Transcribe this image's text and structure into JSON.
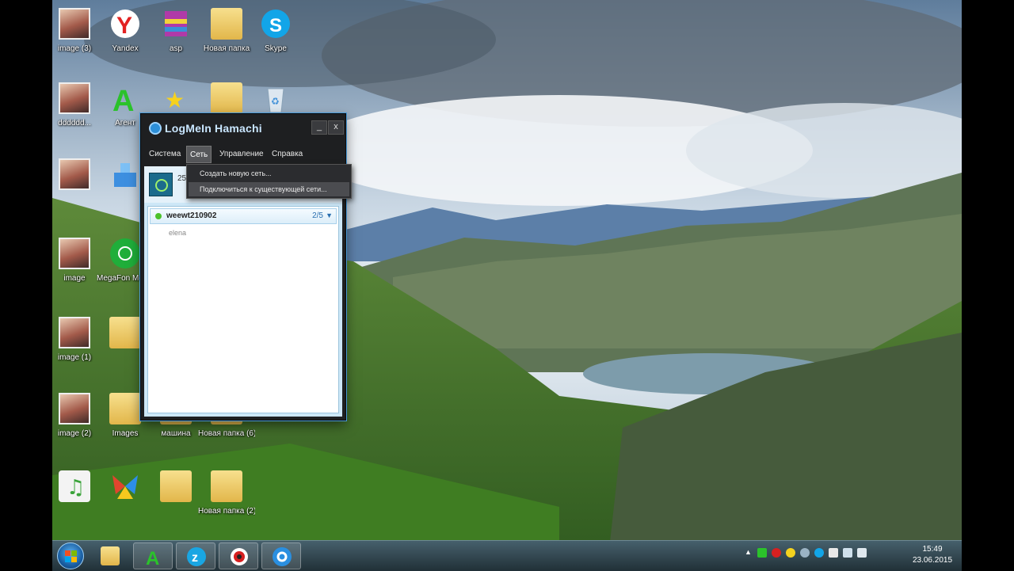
{
  "desktop": {
    "icons": [
      {
        "label": "image (3)",
        "icon": "photo-thumbnail-icon"
      },
      {
        "label": "Yandex",
        "icon": "yandex-browser-icon"
      },
      {
        "label": "asp",
        "icon": "winrar-archive-icon"
      },
      {
        "label": "Новая папка",
        "icon": "folder-icon"
      },
      {
        "label": "Skype",
        "icon": "skype-icon"
      },
      {
        "label": "dddddd...",
        "icon": "photo-thumbnail-icon"
      },
      {
        "label": "Агент",
        "icon": "mail-agent-icon"
      },
      {
        "label": "",
        "icon": "star-icon"
      },
      {
        "label": "",
        "icon": "folder-icon"
      },
      {
        "label": "",
        "icon": "recycle-bin-icon"
      },
      {
        "label": "",
        "icon": "photo-thumbnail-icon"
      },
      {
        "label": "",
        "icon": "shortcut-icon"
      },
      {
        "label": "image",
        "icon": "photo-thumbnail-icon"
      },
      {
        "label": "MegaFon Modem",
        "icon": "megafon-modem-icon"
      },
      {
        "label": "image (1)",
        "icon": "photo-thumbnail-icon"
      },
      {
        "label": "",
        "icon": "folder-icon"
      },
      {
        "label": "image (2)",
        "icon": "photo-thumbnail-icon"
      },
      {
        "label": "Images",
        "icon": "folder-icon"
      },
      {
        "label": "машина",
        "icon": "folder-icon"
      },
      {
        "label": "Новая папка (6)",
        "icon": "folder-icon"
      },
      {
        "label": "",
        "icon": "music-player-icon"
      },
      {
        "label": "",
        "icon": "msn-butterfly-icon"
      },
      {
        "label": "",
        "icon": "folder-icon"
      },
      {
        "label": "Новая папка (2)",
        "icon": "folder-icon"
      }
    ]
  },
  "hamachi": {
    "title": "LogMeIn Hamachi",
    "minimize": "_",
    "close": "x",
    "menu": [
      "Система",
      "Сеть",
      "Управление",
      "Справка"
    ],
    "active_menu": "Сеть",
    "dropdown": [
      "Создать новую сеть...",
      "Подключиться к существующей сети..."
    ],
    "ip_partial": "25",
    "network": {
      "name": "weewt210902",
      "count": "2/5",
      "arrow": "▼"
    },
    "member": "elena"
  },
  "taskbar": {
    "apps": [
      "explorer-icon",
      "mail-agent-icon",
      "zona-icon",
      "hamachi-icon",
      "media-player-icon"
    ],
    "tray_icons": [
      "arrow-up-icon",
      "agent-icon",
      "red-icon",
      "yellow-icon",
      "network-icon",
      "skype-icon",
      "flag-icon",
      "signal-icon",
      "volume-icon"
    ],
    "time": "15:49",
    "date": "23.06.2015"
  }
}
